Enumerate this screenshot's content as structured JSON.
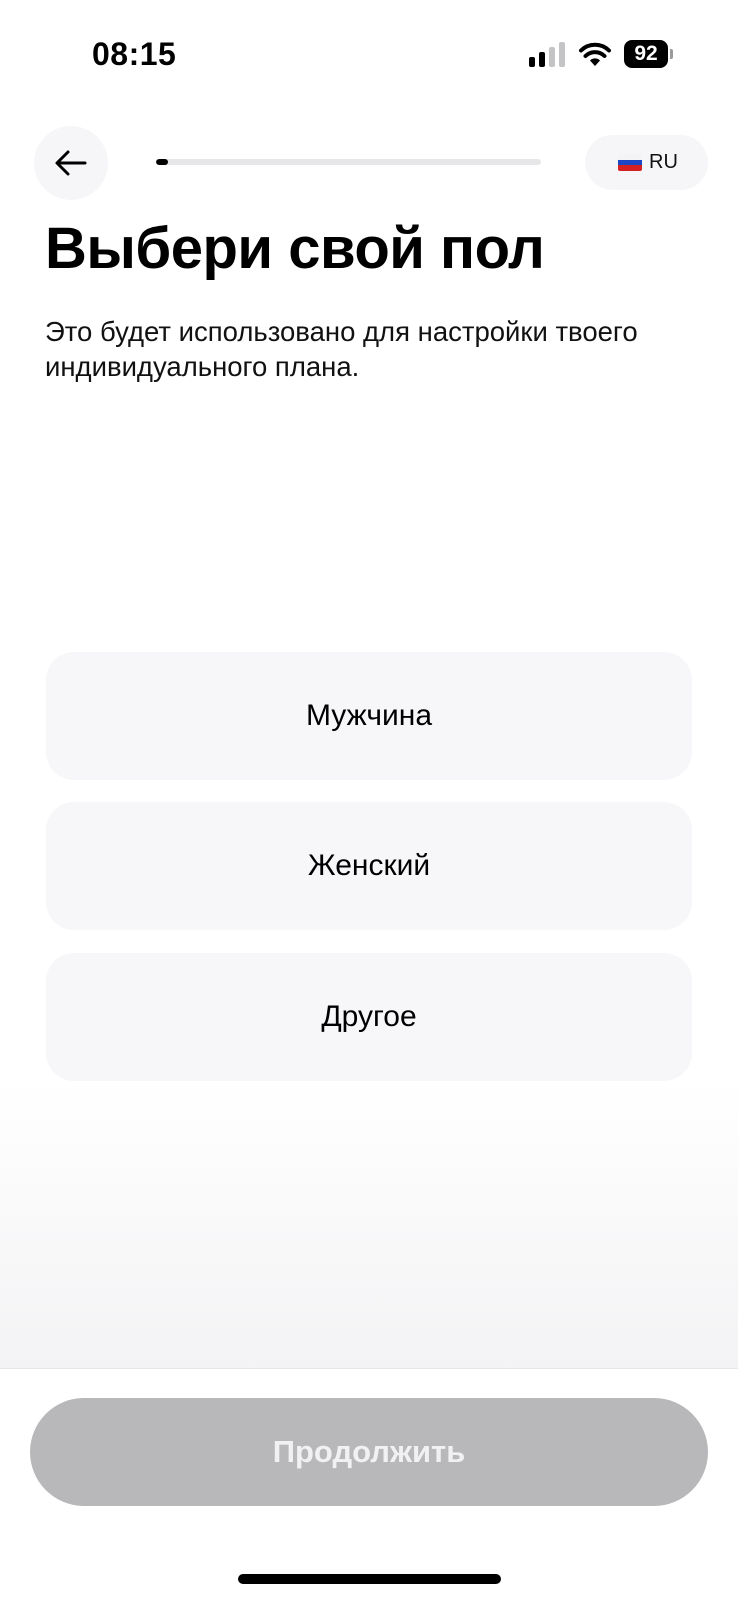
{
  "status_bar": {
    "time": "08:15",
    "battery": "92"
  },
  "header": {
    "back_icon": "arrow-left-icon",
    "progress": 0.03,
    "language": {
      "flag_icon": "russia-flag-icon",
      "label": "RU"
    }
  },
  "main": {
    "title": "Выбери свой пол",
    "subtitle": "Это будет использовано для настройки твоего индивидуального плана.",
    "options": [
      {
        "label": "Мужчина"
      },
      {
        "label": "Женский"
      },
      {
        "label": "Другое"
      }
    ]
  },
  "footer": {
    "continue_label": "Продолжить"
  },
  "colors": {
    "option_background": "#f7f7fa",
    "button_disabled": "#b8b8ba",
    "progress_fill": "#000000",
    "progress_track": "#e7e7ea"
  }
}
